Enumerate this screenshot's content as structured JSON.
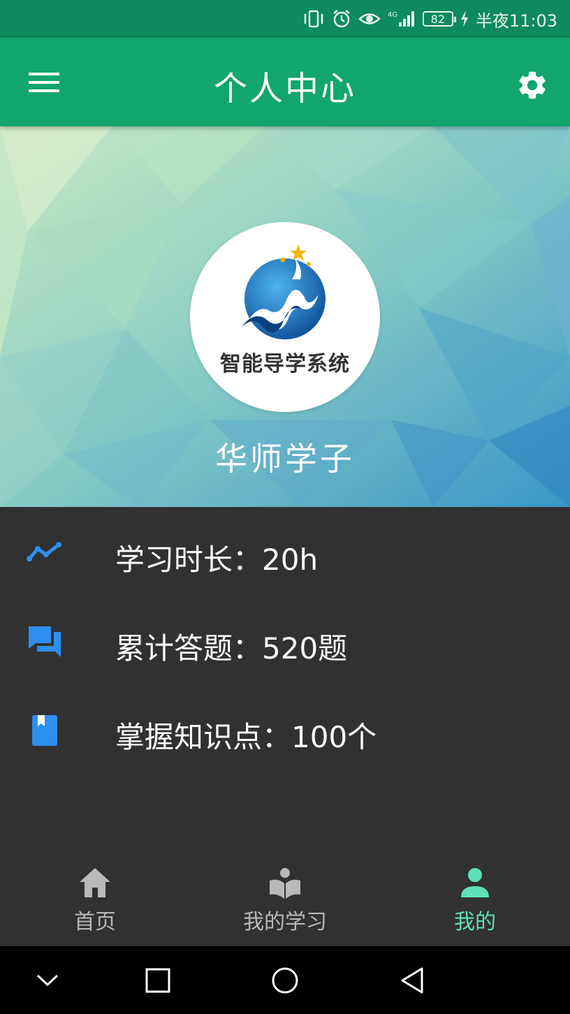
{
  "status_bar": {
    "battery": "82",
    "time": "半夜11:03",
    "icons": [
      "vibrate-icon",
      "alarm-icon",
      "eye-icon",
      "signal-4g-icon",
      "battery-icon",
      "charging-icon"
    ]
  },
  "app_bar": {
    "title": "个人中心",
    "menu_icon": "menu-icon",
    "settings_icon": "gear-icon",
    "color": "#12a56e"
  },
  "profile": {
    "logo_text": "智能导学系统",
    "name": "华师学子"
  },
  "stats": [
    {
      "icon": "trending-icon",
      "label": "学习时长：20h"
    },
    {
      "icon": "chat-icon",
      "label": "累计答题：520题"
    },
    {
      "icon": "bookmark-book-icon",
      "label": "掌握知识点：100个"
    }
  ],
  "bottom_nav": {
    "items": [
      {
        "label": "首页",
        "icon": "home-icon",
        "active": false
      },
      {
        "label": "我的学习",
        "icon": "reading-icon",
        "active": false
      },
      {
        "label": "我的",
        "icon": "person-icon",
        "active": true
      }
    ],
    "active_color": "#5fe0b8",
    "inactive_color": "#b9b9b9"
  },
  "system_nav": [
    "chevron-down-icon",
    "recent-apps-icon",
    "home-circle-icon",
    "back-icon"
  ]
}
